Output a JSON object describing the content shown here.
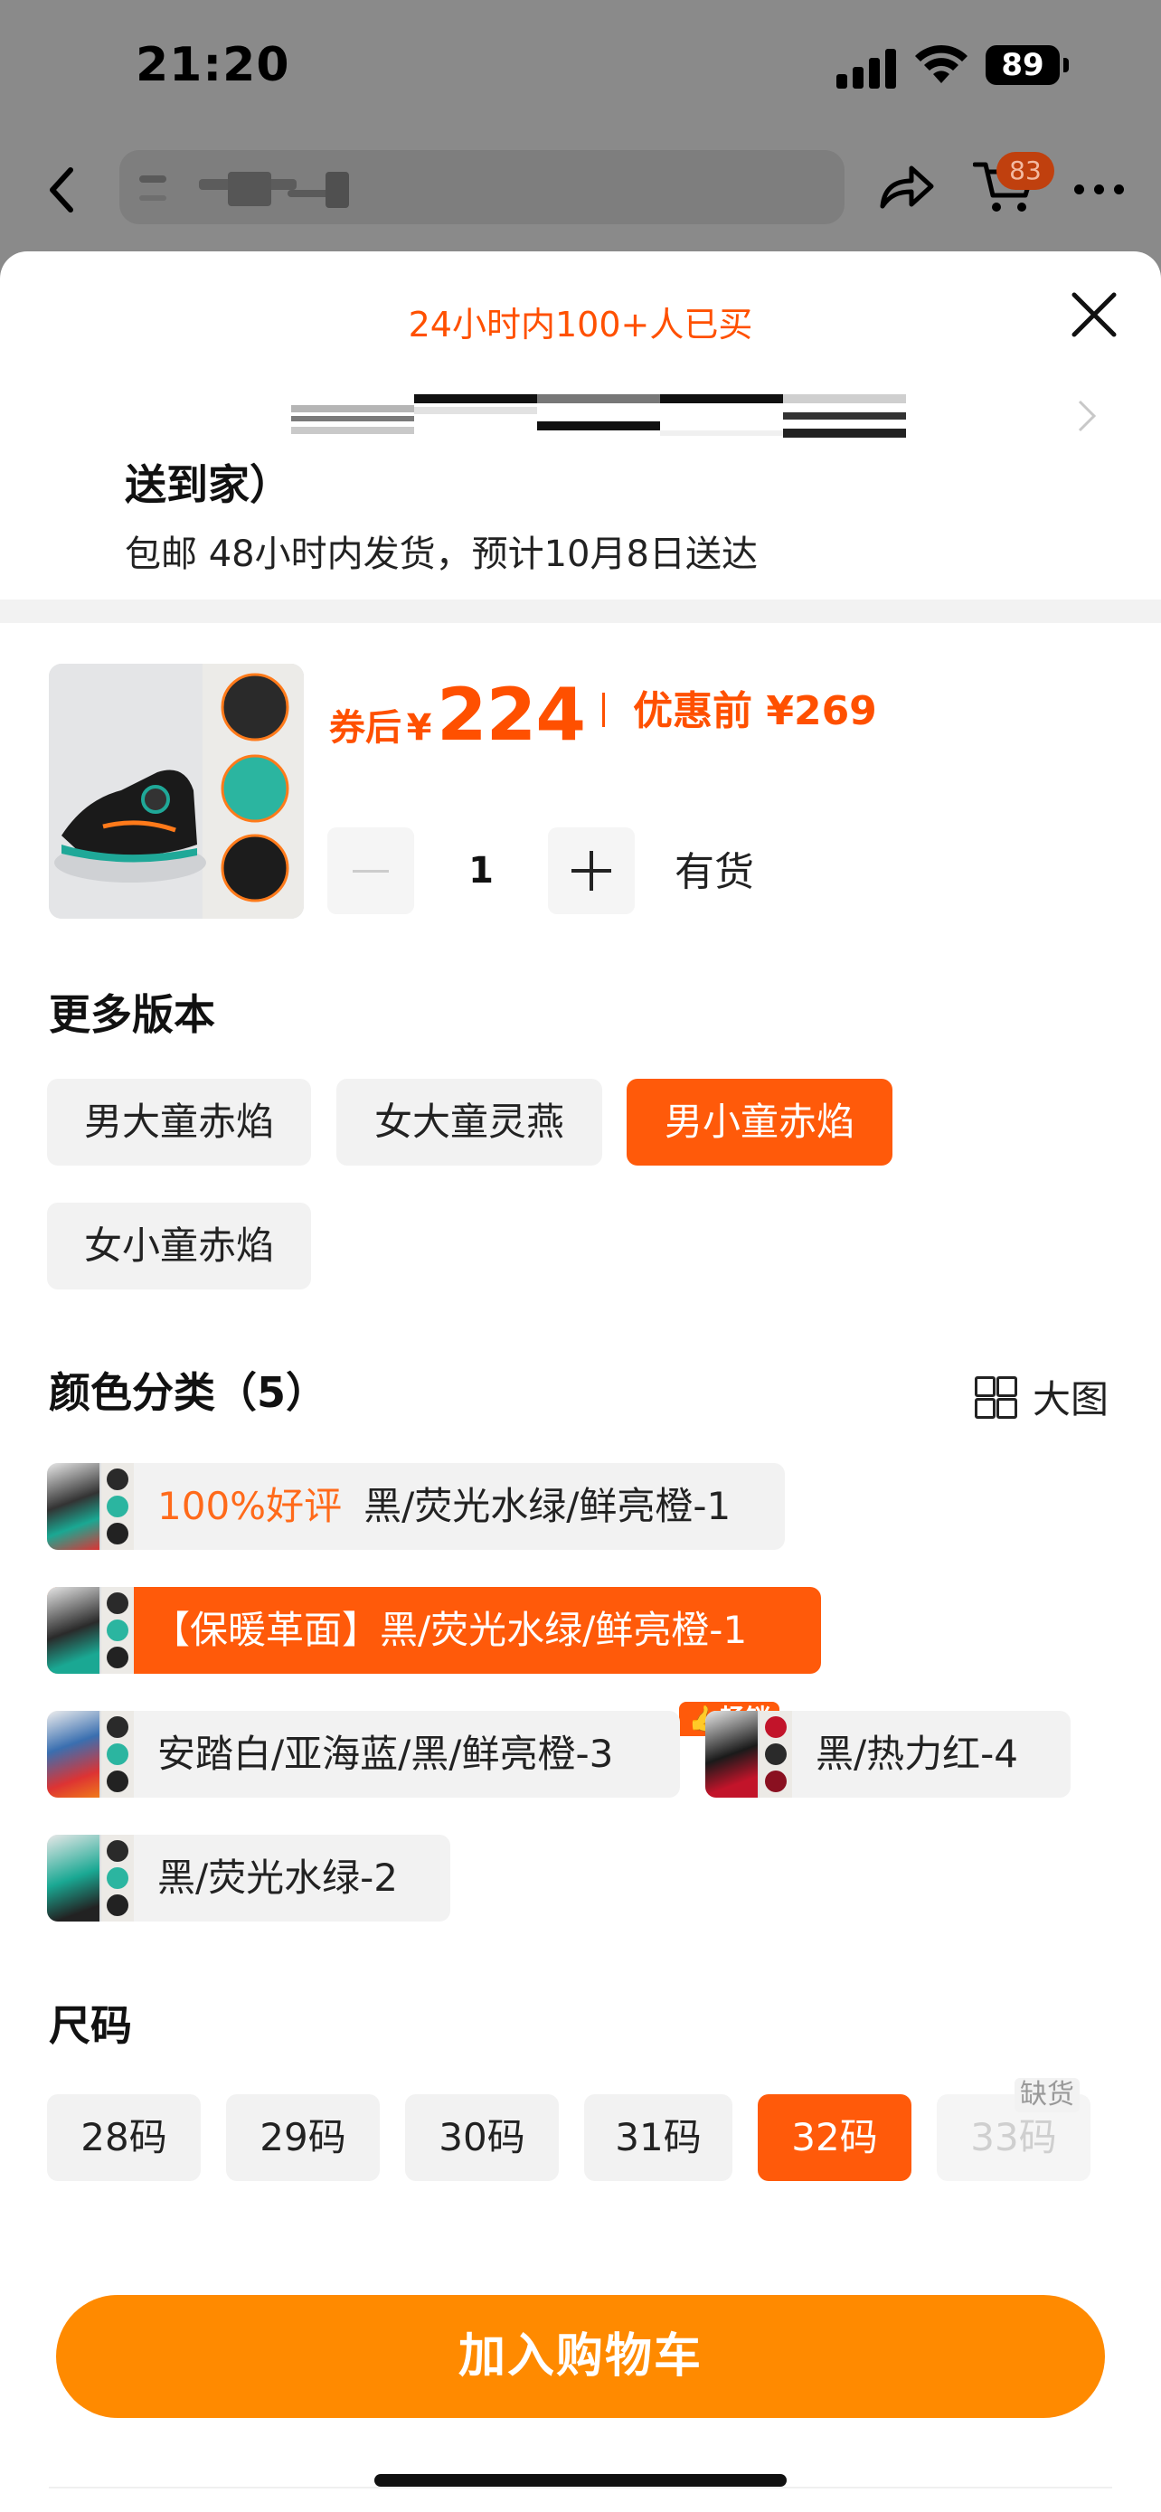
{
  "status_bar": {
    "time": "21:20",
    "battery": "89"
  },
  "nav": {
    "cart_badge": "83"
  },
  "sheet": {
    "promo": "24小时内100+人已买",
    "address_line": "送到家）",
    "shipping": "包邮 48小时内发货，预计10月8日送达"
  },
  "product": {
    "price_after_label": "券后",
    "currency": "¥",
    "price_after": "224",
    "price_before_label": "优惠前",
    "price_before": "269",
    "quantity": "1",
    "stock": "有货"
  },
  "versions": {
    "title": "更多版本",
    "options": [
      "男大童赤焰",
      "女大童灵燕",
      "男小童赤焰",
      "女小童赤焰"
    ],
    "selected": "男小童赤焰"
  },
  "colors": {
    "title": "颜色分类（5）",
    "big_view": "大图",
    "hot_badge": "畅销",
    "good_review_tag": "100%好评",
    "options": [
      "黑/荧光水绿/鲜亮橙-1",
      "【保暖革面】黑/荧光水绿/鲜亮橙-1",
      "安踏白/亚海蓝/黑/鲜亮橙-3",
      "黑/热力红-4",
      "黑/荧光水绿-2"
    ],
    "selected": "【保暖革面】黑/荧光水绿/鲜亮橙-1"
  },
  "sizes": {
    "title": "尺码",
    "options": [
      "28码",
      "29码",
      "30码",
      "31码",
      "32码",
      "33码"
    ],
    "selected": "32码",
    "out_of_stock_badge": "缺货"
  },
  "add_to_cart": "加入购物车",
  "colors_palette": {
    "accent": "#ff5a0a",
    "button": "#ff8a00",
    "price": "#ff5000"
  }
}
